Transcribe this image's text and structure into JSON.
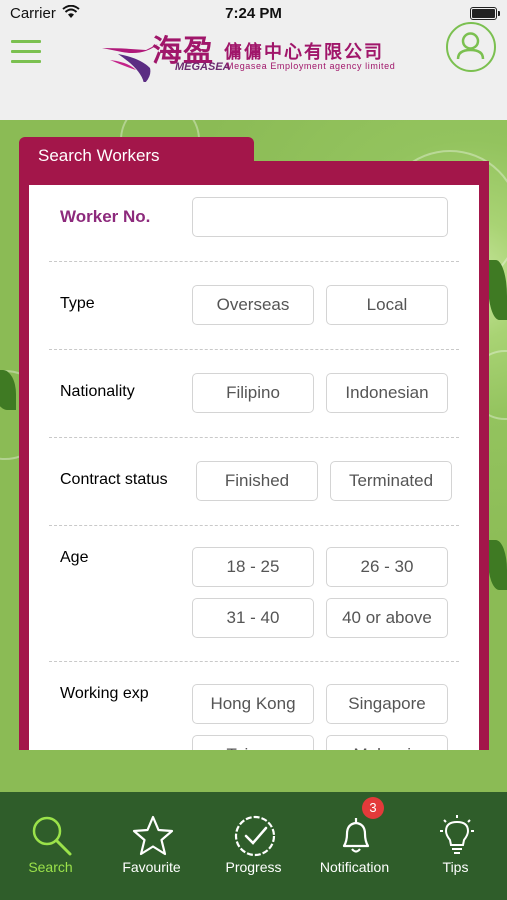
{
  "status_bar": {
    "carrier": "Carrier",
    "time": "7:24 PM"
  },
  "header": {
    "brand_cn": "海盈",
    "brand_en": "MEGASEA",
    "company_cn": "傭傭中心有限公司",
    "company_en": "Megasea Employment agency limited"
  },
  "search": {
    "tab_title": "Search Workers",
    "worker_no": {
      "label": "Worker No.",
      "value": "",
      "placeholder": ""
    },
    "type": {
      "label": "Type",
      "options": [
        "Overseas",
        "Local"
      ]
    },
    "nationality": {
      "label": "Nationality",
      "options": [
        "Filipino",
        "Indonesian"
      ]
    },
    "contract_status": {
      "label": "Contract status",
      "options": [
        "Finished",
        "Terminated"
      ]
    },
    "age": {
      "label": "Age",
      "options": [
        "18 - 25",
        "26 - 30",
        "31 - 40",
        "40 or above"
      ]
    },
    "working_exp": {
      "label": "Working exp",
      "options": [
        "Hong Kong",
        "Singapore",
        "Taiwan",
        "Malaysia"
      ]
    }
  },
  "bottom_nav": {
    "items": [
      {
        "label": "Search",
        "icon": "search-icon",
        "active": true
      },
      {
        "label": "Favourite",
        "icon": "star-icon",
        "active": false
      },
      {
        "label": "Progress",
        "icon": "check-circle-icon",
        "active": false
      },
      {
        "label": "Notification",
        "icon": "bell-icon",
        "active": false
      },
      {
        "label": "Tips",
        "icon": "lightbulb-icon",
        "active": false
      }
    ],
    "notification_badge": "3"
  },
  "colors": {
    "accent": "#a3164a",
    "label": "#8d2a7c",
    "nav_bg": "#2f5d2a",
    "nav_active": "#9be24a",
    "menu": "#7bc050"
  }
}
